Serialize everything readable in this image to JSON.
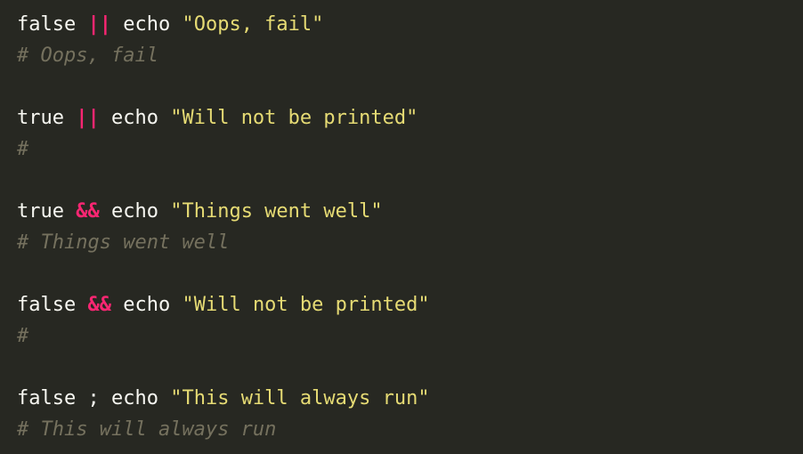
{
  "lines": [
    {
      "cmd": "false",
      "op": "||",
      "echo": "echo",
      "str": "\"Oops, fail\"",
      "comment": "# Oops, fail"
    },
    {
      "cmd": "true",
      "op": "||",
      "echo": "echo",
      "str": "\"Will not be printed\"",
      "comment": "#"
    },
    {
      "cmd": "true",
      "op": "&&",
      "echo": "echo",
      "str": "\"Things went well\"",
      "comment": "# Things went well"
    },
    {
      "cmd": "false",
      "op": "&&",
      "echo": "echo",
      "str": "\"Will not be printed\"",
      "comment": "#"
    },
    {
      "cmd": "false",
      "op": ";",
      "echo": "echo",
      "str": "\"This will always run\"",
      "comment": "# This will always run"
    }
  ],
  "colors": {
    "background": "#272822",
    "text": "#f8f8f2",
    "operator": "#f92672",
    "string": "#e6db74",
    "comment": "#75715e"
  }
}
